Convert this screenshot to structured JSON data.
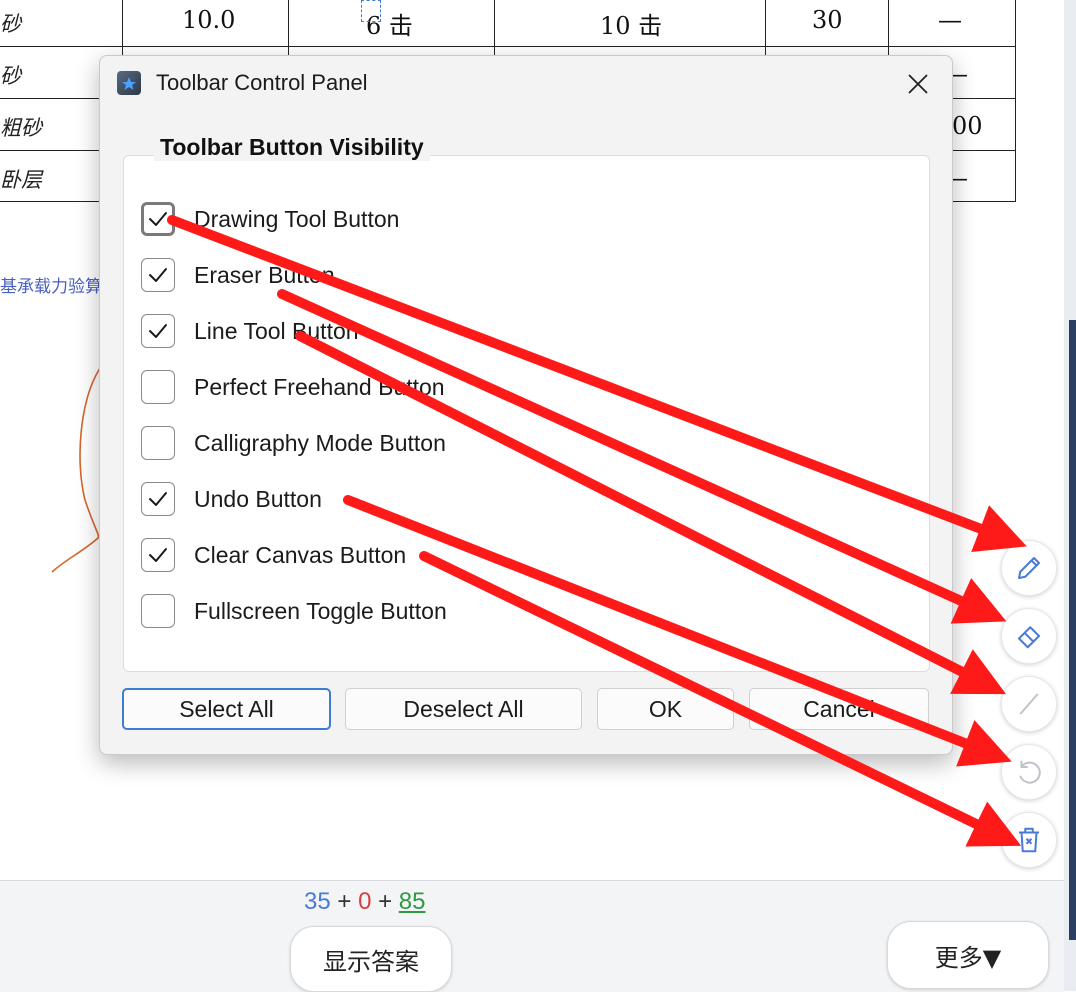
{
  "document": {
    "table_rows": [
      {
        "label": "砂",
        "cells": [
          "10.0",
          "6 击",
          "10 击",
          "30",
          "—"
        ]
      },
      {
        "label": "砂",
        "cells": [
          "",
          "",
          "",
          "",
          "—"
        ]
      },
      {
        "label": "粗砂",
        "cells": [
          "",
          "",
          "",
          "",
          "00"
        ]
      },
      {
        "label": "卧层",
        "cells": [
          "",
          "",
          "",
          "",
          "—"
        ]
      }
    ],
    "link_text": "基承载力验算"
  },
  "dialog": {
    "title": "Toolbar Control Panel",
    "group_title": "Toolbar Button Visibility",
    "items": [
      {
        "label": "Drawing Tool Button",
        "checked": true
      },
      {
        "label": "Eraser Button",
        "checked": true
      },
      {
        "label": "Line Tool Button",
        "checked": true
      },
      {
        "label": "Perfect Freehand Button",
        "checked": false
      },
      {
        "label": "Calligraphy Mode Button",
        "checked": false
      },
      {
        "label": "Undo Button",
        "checked": true
      },
      {
        "label": "Clear Canvas Button",
        "checked": true
      },
      {
        "label": "Fullscreen Toggle Button",
        "checked": false
      }
    ],
    "buttons": {
      "select_all": "Select All",
      "deselect_all": "Deselect All",
      "ok": "OK",
      "cancel": "Cancel"
    }
  },
  "toolbar": {
    "icons": [
      "pencil-icon",
      "eraser-icon",
      "line-icon",
      "undo-icon",
      "trash-icon"
    ]
  },
  "bottom": {
    "score": {
      "a": "35",
      "op1": "+",
      "b": "0",
      "op2": "+",
      "c": "85"
    },
    "show_answer": "显示答案",
    "more": "更多▼"
  },
  "colors": {
    "arrow": "#ff1a1a",
    "accent": "#3d7bd4"
  }
}
